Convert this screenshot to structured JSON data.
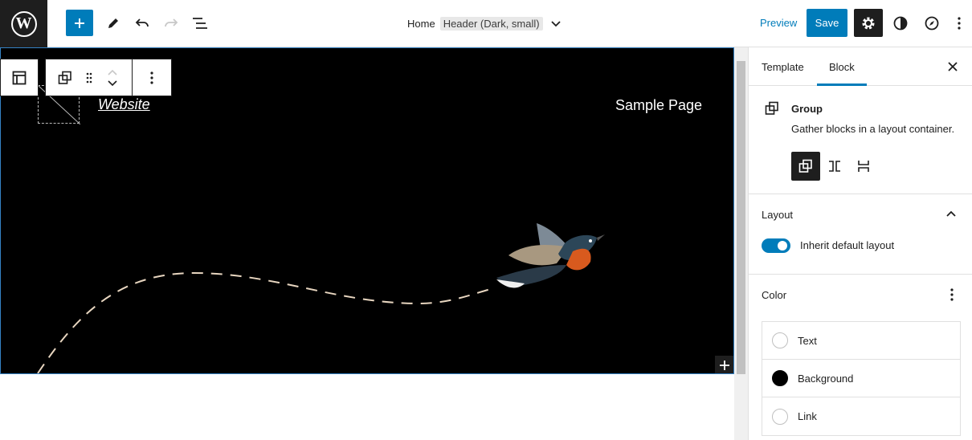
{
  "topbar": {
    "logo": "wordpress-logo",
    "breadcrumb_home": "Home",
    "template_name": "Header (Dark, small)",
    "preview_label": "Preview",
    "save_label": "Save"
  },
  "canvas": {
    "site_title": "Website",
    "nav_link": "Sample Page"
  },
  "sidebar": {
    "tabs": [
      {
        "label": "Template",
        "active": false
      },
      {
        "label": "Block",
        "active": true
      }
    ],
    "block_name": "Group",
    "block_description": "Gather blocks in a layout container.",
    "layout": {
      "title": "Layout",
      "toggle_label": "Inherit default layout",
      "toggle_on": true
    },
    "color": {
      "title": "Color",
      "items": [
        {
          "label": "Text",
          "swatch": "#ffffff"
        },
        {
          "label": "Background",
          "swatch": "#000000"
        },
        {
          "label": "Link",
          "swatch": "#ffffff"
        }
      ]
    }
  },
  "colors": {
    "accent": "#007cba",
    "dark": "#1e1e1e",
    "canvas_bg": "#000000"
  }
}
